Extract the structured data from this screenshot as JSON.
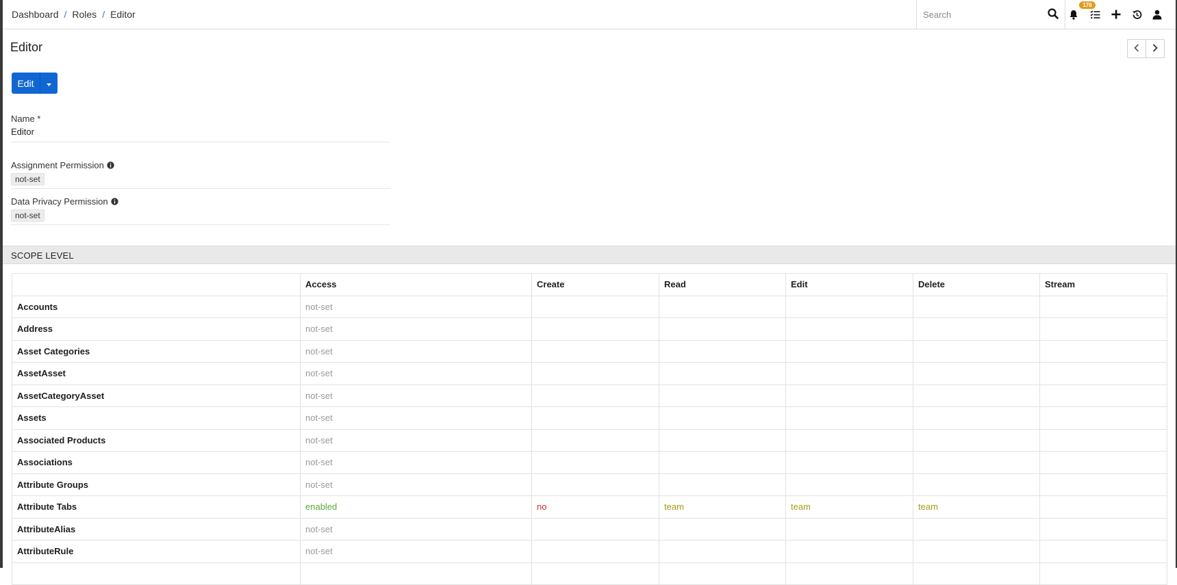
{
  "breadcrumb": [
    "Dashboard",
    "Roles",
    "Editor"
  ],
  "search": {
    "placeholder": "Search"
  },
  "notifications": {
    "count": "176"
  },
  "icons": {
    "search": "search-icon",
    "bell": "bell-icon",
    "tasks": "task-list-icon",
    "create": "plus-icon",
    "history": "history-icon",
    "user": "user-icon",
    "prev": "chevron-left-icon",
    "next": "chevron-right-icon",
    "caret": "caret-down-icon",
    "info": "info-icon"
  },
  "page": {
    "title": "Editor",
    "edit_label": "Edit"
  },
  "fields": {
    "name": {
      "label": "Name *",
      "value": "Editor"
    },
    "assignment": {
      "label": "Assignment Permission",
      "value": "not-set"
    },
    "privacy": {
      "label": "Data Privacy Permission",
      "value": "not-set"
    }
  },
  "section": {
    "title": "SCOPE LEVEL"
  },
  "table": {
    "headers": [
      "",
      "Access",
      "Create",
      "Read",
      "Edit",
      "Delete",
      "Stream"
    ],
    "rows": [
      {
        "scope": "Accounts",
        "access": "not-set",
        "create": "",
        "read": "",
        "edit": "",
        "delete": "",
        "stream": ""
      },
      {
        "scope": "Address",
        "access": "not-set",
        "create": "",
        "read": "",
        "edit": "",
        "delete": "",
        "stream": ""
      },
      {
        "scope": "Asset Categories",
        "access": "not-set",
        "create": "",
        "read": "",
        "edit": "",
        "delete": "",
        "stream": ""
      },
      {
        "scope": "AssetAsset",
        "access": "not-set",
        "create": "",
        "read": "",
        "edit": "",
        "delete": "",
        "stream": ""
      },
      {
        "scope": "AssetCategoryAsset",
        "access": "not-set",
        "create": "",
        "read": "",
        "edit": "",
        "delete": "",
        "stream": ""
      },
      {
        "scope": "Assets",
        "access": "not-set",
        "create": "",
        "read": "",
        "edit": "",
        "delete": "",
        "stream": ""
      },
      {
        "scope": "Associated Products",
        "access": "not-set",
        "create": "",
        "read": "",
        "edit": "",
        "delete": "",
        "stream": ""
      },
      {
        "scope": "Associations",
        "access": "not-set",
        "create": "",
        "read": "",
        "edit": "",
        "delete": "",
        "stream": ""
      },
      {
        "scope": "Attribute Groups",
        "access": "not-set",
        "create": "",
        "read": "",
        "edit": "",
        "delete": "",
        "stream": ""
      },
      {
        "scope": "Attribute Tabs",
        "access": "enabled",
        "create": "no",
        "read": "team",
        "edit": "team",
        "delete": "team",
        "stream": ""
      },
      {
        "scope": "AttributeAlias",
        "access": "not-set",
        "create": "",
        "read": "",
        "edit": "",
        "delete": "",
        "stream": ""
      },
      {
        "scope": "AttributeRule",
        "access": "not-set",
        "create": "",
        "read": "",
        "edit": "",
        "delete": "",
        "stream": ""
      },
      {
        "scope": "",
        "access": "",
        "create": "",
        "read": "",
        "edit": "",
        "delete": "",
        "stream": ""
      }
    ]
  },
  "colors": {
    "primary": "#1067d3",
    "badge": "#e39b1e",
    "enabled": "#5aa937",
    "no": "#d9262a",
    "team": "#a89a1a",
    "not_set": "#9a9a9a"
  }
}
